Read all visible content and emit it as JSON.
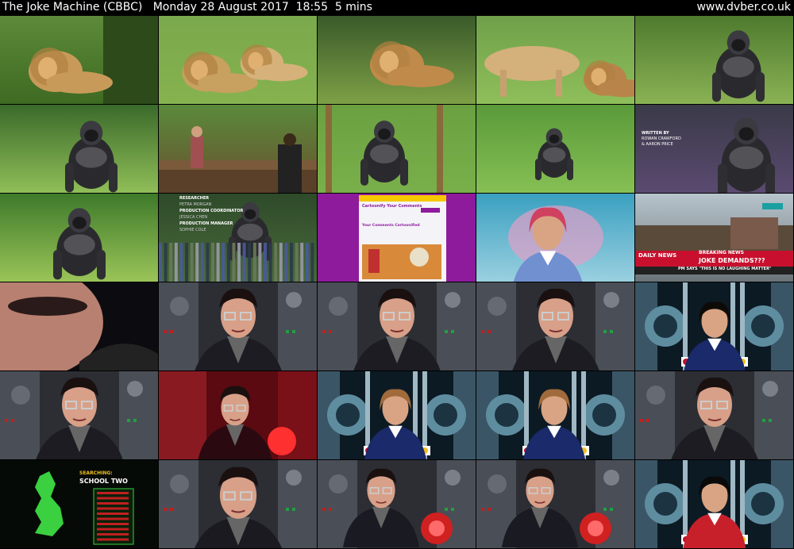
{
  "header": {
    "title": "The Joke Machine (CBBC)   Monday 28 August 2017  18:55  5 mins",
    "site": "www.dvber.co.uk"
  },
  "colors": {
    "background": "#000000",
    "text": "#ffffff",
    "breaking_red": "#c8102e",
    "grass_green": "#5fa83a",
    "purple_page": "#8e1b9c"
  },
  "thumbnails": [
    {
      "scene": "lion-lying"
    },
    {
      "scene": "lioness-pair"
    },
    {
      "scene": "lion-sitting"
    },
    {
      "scene": "lioness-lion"
    },
    {
      "scene": "gorilla-walking"
    },
    {
      "scene": "gorilla-grass"
    },
    {
      "scene": "zoo-visitors"
    },
    {
      "scene": "gorilla-sitting"
    },
    {
      "scene": "gorilla-field"
    },
    {
      "scene": "gorilla-credits",
      "credits": [
        "WRITTEN BY",
        "ROWAN CRAWFORD",
        "& AARON PRICE"
      ]
    },
    {
      "scene": "gorilla-grass-2"
    },
    {
      "scene": "gorilla-credits-2",
      "credits": [
        "RESEARCHER",
        "PETRA MORGAN",
        "PRODUCTION COORDINATOR",
        "JESSICA CHEN",
        "PRODUCTION MANAGER",
        "SOPHIE COLE"
      ]
    },
    {
      "scene": "web-page",
      "page_title": "Cartoonify Your Comments",
      "page_sub": "Your Comments Cartoonified"
    },
    {
      "scene": "boy-paint"
    },
    {
      "scene": "breaking-news",
      "badge_left": "DAILY NEWS",
      "badge_right": "BREAKING NEWS",
      "headline": "JOKE DEMANDS???",
      "subline": "PM SAYS \"THIS IS NO LAUGHING MATTER\""
    },
    {
      "scene": "closeup"
    },
    {
      "scene": "host"
    },
    {
      "scene": "host"
    },
    {
      "scene": "host"
    },
    {
      "scene": "girl-pod"
    },
    {
      "scene": "host"
    },
    {
      "scene": "host-red"
    },
    {
      "scene": "girl-pod-2"
    },
    {
      "scene": "girl-pod-2"
    },
    {
      "scene": "host"
    },
    {
      "scene": "map",
      "searching": "SEARCHING:",
      "school": "SCHOOL TWO"
    },
    {
      "scene": "host-smile"
    },
    {
      "scene": "host-machine"
    },
    {
      "scene": "host-machine"
    },
    {
      "scene": "boy-pod"
    }
  ]
}
